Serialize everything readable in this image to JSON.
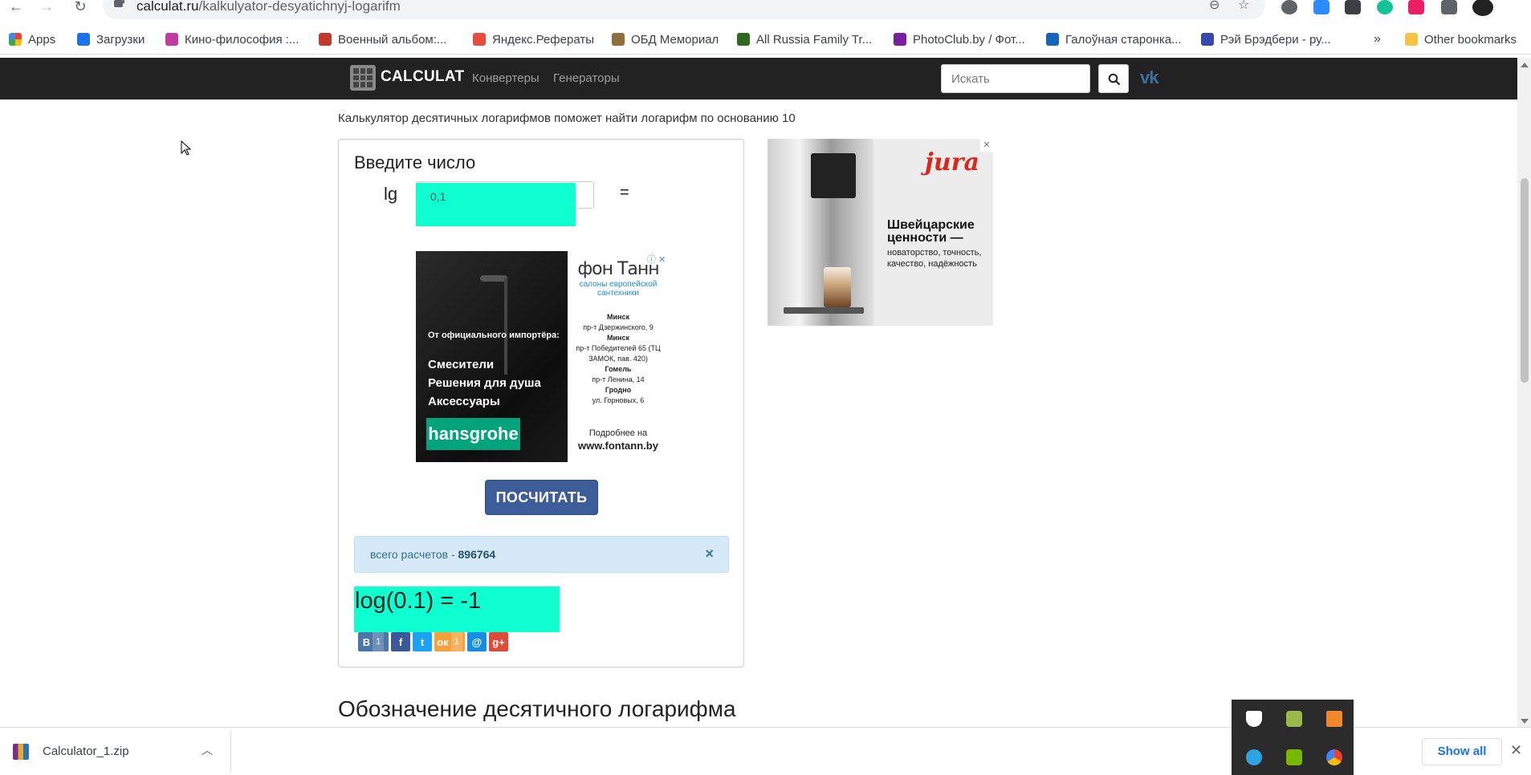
{
  "browser": {
    "url_domain": "calculat.ru",
    "url_path": "/kalkulyator-desyatichnyj-logarifm",
    "bookmarks": [
      {
        "label": "Apps",
        "icon": "apps-grid-icon",
        "color": "#ea4335"
      },
      {
        "label": "Загрузки",
        "icon": "download-icon",
        "color": "#1a73e8"
      },
      {
        "label": "Кино-философия :...",
        "icon": "star-icon",
        "color": "#c03aa0"
      },
      {
        "label": "Военный альбом:...",
        "icon": "a-icon",
        "color": "#c0392b"
      },
      {
        "label": "Яндекс.Рефераты",
        "icon": "yandex-icon",
        "color": "#e74c3c"
      },
      {
        "label": "ОБД Мемориал",
        "icon": "memorial-icon",
        "color": "#8e6e3b"
      },
      {
        "label": "All Russia Family Tr...",
        "icon": "tree-icon",
        "color": "#2d6a1e"
      },
      {
        "label": "PhotoClub.by / Фот...",
        "icon": "pc-icon",
        "color": "#7b1fa2"
      },
      {
        "label": "Галоўная старонка...",
        "icon": "k-icon",
        "color": "#1565c0"
      },
      {
        "label": "Рэй Брэдбери - ру...",
        "icon": "rb-icon",
        "color": "#3949ab"
      }
    ],
    "more_label": "»",
    "other_bookmarks": "Other bookmarks"
  },
  "header": {
    "logo_text": "CALCULAT",
    "nav": [
      "Конвертеры",
      "Генераторы"
    ],
    "search_placeholder": "Искать",
    "vk_label": "vk"
  },
  "content": {
    "intro": "Калькулятор десятичных логарифмов поможет найти логарифм по основанию 10",
    "panel_heading": "Введите число",
    "lg_label": "lg",
    "input_value": "0,1",
    "equals": "=",
    "calc_button": "ПОСЧИТАТЬ",
    "counter_text": "всего расчетов - ",
    "counter_value": "896764",
    "close_symbol": "×",
    "result": "log(0.1) = -1",
    "share": [
      {
        "label": "В",
        "count": "1",
        "color": "#4a76a8"
      },
      {
        "label": "f",
        "count": "",
        "color": "#3b5998"
      },
      {
        "label": "t",
        "count": "",
        "color": "#1da1f2"
      },
      {
        "label": "ок",
        "count": "1",
        "color": "#f4a13c"
      },
      {
        "label": "@",
        "count": "",
        "color": "#168de2"
      },
      {
        "label": "g+",
        "count": "",
        "color": "#dd4b39"
      }
    ],
    "section_title": "Обозначение десятичного логарифма"
  },
  "ad_inline": {
    "import_text": "От официального импортёра:",
    "items": [
      "Смесители",
      "Решения для душа",
      "Аксессуары"
    ],
    "brand": "hansgrohe",
    "right_logo": "фон Танн",
    "right_tag": "салоны европейской сантехники",
    "addresses": [
      {
        "city": "Минск",
        "addr": "пр-т Дзержинского, 9"
      },
      {
        "city": "Минск",
        "addr": "пр-т Победителей 65 (ТЦ ЗАМОК, пав. 420)"
      },
      {
        "city": "Гомель",
        "addr": "пр-т Ленина, 14"
      },
      {
        "city": "Гродно",
        "addr": "ул. Горновых, 6"
      }
    ],
    "more": "Подробнее на",
    "site": "www.fontann.by"
  },
  "ad_side": {
    "brand": "jura",
    "headline": "Швейцарские ценности —",
    "sub": "новаторство, точность, качество, надёжность"
  },
  "downloads": {
    "file": "Calculator_1.zip",
    "show_all": "Show all"
  }
}
